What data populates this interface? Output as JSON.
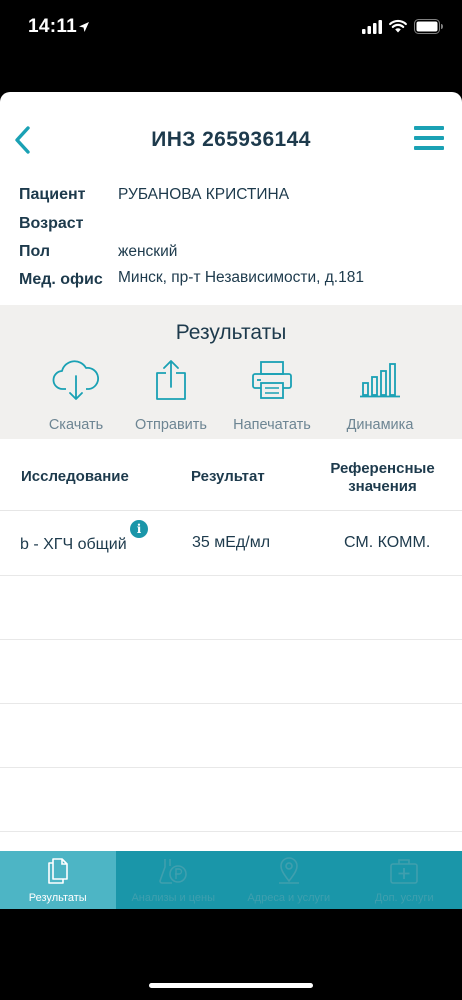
{
  "status_bar": {
    "time": "14:11"
  },
  "nav": {
    "title": "ИНЗ 265936144"
  },
  "patient": {
    "rows": [
      {
        "label": "Пациент",
        "value": "РУБАНОВА КРИСТИНА"
      },
      {
        "label": "Возраст",
        "value": ""
      },
      {
        "label": "Пол",
        "value": "женский"
      },
      {
        "label": "Мед. офис",
        "value": "Минск, пр-т Независимости, д.181"
      }
    ]
  },
  "results": {
    "title": "Результаты",
    "actions": [
      {
        "label": "Скачать",
        "icon": "cloud-download-icon"
      },
      {
        "label": "Отправить",
        "icon": "share-icon"
      },
      {
        "label": "Напечатать",
        "icon": "printer-icon"
      },
      {
        "label": "Динамика",
        "icon": "bar-chart-icon"
      }
    ]
  },
  "table": {
    "headers": {
      "study": "Исследование",
      "result": "Результат",
      "reference_line1": "Референсные",
      "reference_line2": "значения"
    },
    "rows": [
      {
        "study": "b - ХГЧ общий",
        "result": "35 мЕд/мл",
        "reference": "СМ. КОММ.",
        "info_badge": "i"
      }
    ]
  },
  "tab_bar": {
    "tabs": [
      {
        "label": "Результаты",
        "icon": "document-icon",
        "active": true
      },
      {
        "label": "Анализы и цены",
        "icon": "flask-price-icon",
        "active": false
      },
      {
        "label": "Адреса и услуги",
        "icon": "map-pin-icon",
        "active": false
      },
      {
        "label": "Доп. услуги",
        "icon": "medical-kit-icon",
        "active": false
      }
    ]
  },
  "colors": {
    "accent": "#1a96a9",
    "tab_active": "#4db5c5",
    "text": "#1d3a4c",
    "panel": "#f1f0ee"
  }
}
